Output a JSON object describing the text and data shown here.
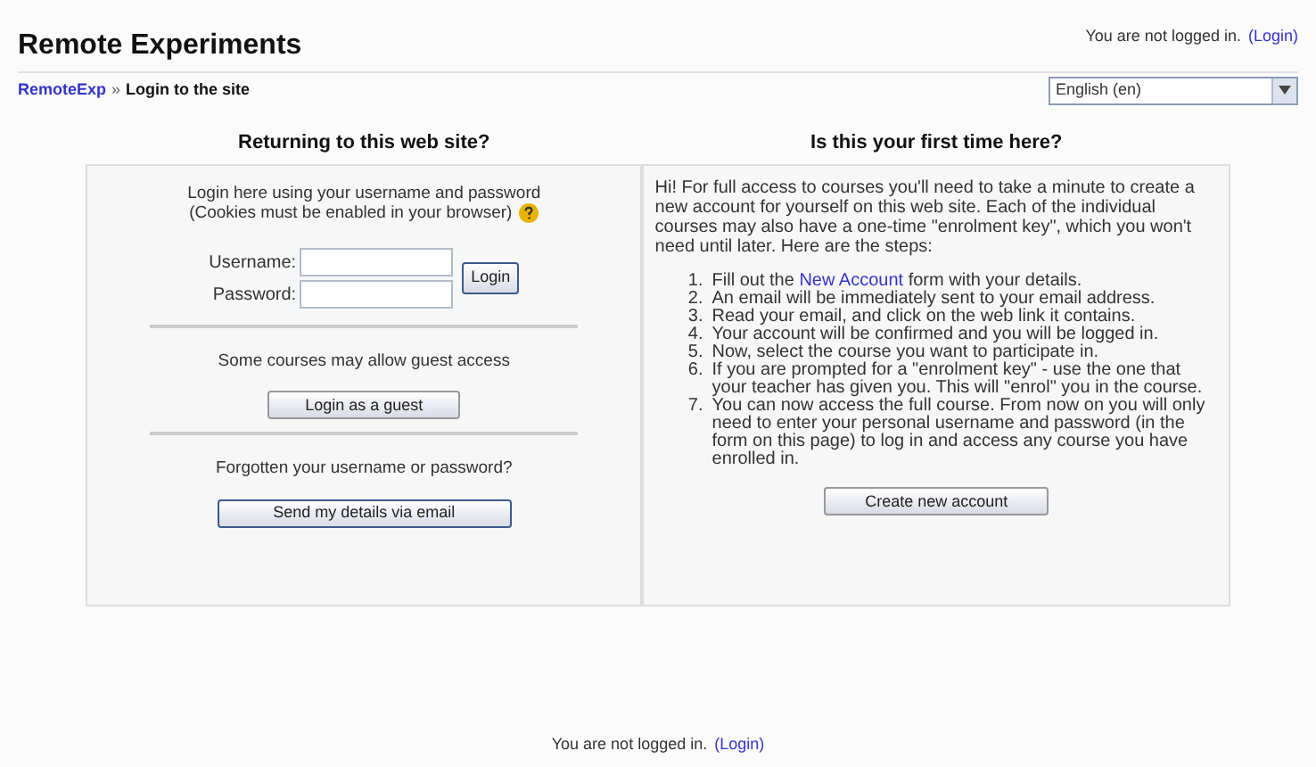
{
  "header": {
    "title": "Remote Experiments",
    "login_info": {
      "text": "You are not logged in.",
      "link": "(Login)"
    }
  },
  "breadcrumb": {
    "home": "RemoteExp",
    "separator": "»",
    "current": "Login to the site"
  },
  "language": {
    "value": "English (en)"
  },
  "returning": {
    "heading": "Returning to this web site?",
    "intro": [
      "Login here using your username and password",
      "(Cookies must be enabled in your browser)"
    ],
    "username": {
      "label": "Username:"
    },
    "password": {
      "label": "Password:"
    },
    "login_button": "Login",
    "guest_text": "Some courses may allow guest access",
    "guest_button": "Login as a guest",
    "forgot_text": "Forgotten your username or password?",
    "forgot_button": "Send my details via email"
  },
  "first_time": {
    "heading": "Is this your first time here?",
    "intro": "Hi! For full access to courses you'll need to take a minute to create a new account for yourself on this web site. Each of the individual courses may also have a one-time \"enrolment key\", which you won't need until later. Here are the steps:",
    "steps": [
      {
        "number": "1.",
        "before": "Fill out the ",
        "link": "New Account",
        "after": " form with your details."
      },
      {
        "number": "2.",
        "text": "An email will be immediately sent to your email address."
      },
      {
        "number": "3.",
        "text": "Read your email, and click on the web link it contains."
      },
      {
        "number": "4.",
        "text": "Your account will be confirmed and you will be logged in."
      },
      {
        "number": "5.",
        "text": "Now, select the course you want to participate in."
      },
      {
        "number": "6.",
        "text": "If you are prompted for a \"enrolment key\" - use the one that your teacher has given you. This will \"enrol\" you in the course."
      },
      {
        "number": "7.",
        "text": "You can now access the full course. From now on you will only need to enter your personal username and password (in the form on this page) to log in and access any course you have enrolled in."
      }
    ],
    "button": "Create new account"
  },
  "footer": {
    "text": "You are not logged in.",
    "link": "(Login)"
  }
}
